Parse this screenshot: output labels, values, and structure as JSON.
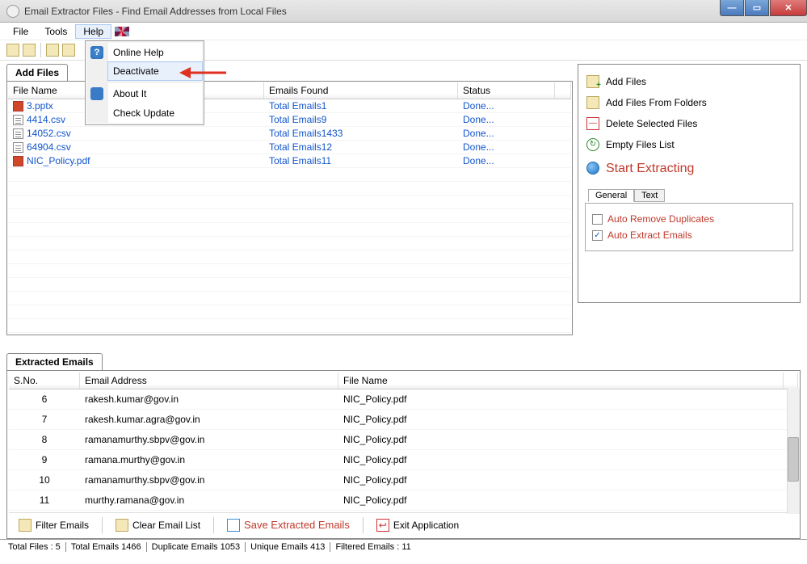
{
  "window": {
    "title": "Email Extractor Files -  Find Email Addresses from Local Files"
  },
  "menubar": {
    "file": "File",
    "tools": "Tools",
    "help": "Help"
  },
  "help_menu": {
    "online_help": "Online Help",
    "deactivate": "Deactivate",
    "about": "About It",
    "check_update": "Check Update"
  },
  "tabs": {
    "add_files": "Add Files",
    "extracted_emails": "Extracted Emails"
  },
  "file_table": {
    "headers": {
      "name": "File Name",
      "emails": "Emails Found",
      "status": "Status"
    },
    "rows": [
      {
        "name": "3.pptx",
        "type": "pptx",
        "emails": "Total Emails1",
        "status": "Done..."
      },
      {
        "name": "4414.csv",
        "type": "csv",
        "emails": "Total Emails9",
        "status": "Done..."
      },
      {
        "name": "14052.csv",
        "type": "csv",
        "emails": "Total Emails1433",
        "status": "Done..."
      },
      {
        "name": "64904.csv",
        "type": "csv",
        "emails": "Total Emails12",
        "status": "Done..."
      },
      {
        "name": "NIC_Policy.pdf",
        "type": "pdf",
        "emails": "Total Emails11",
        "status": "Done..."
      }
    ]
  },
  "sidebar": {
    "add_files": "Add Files",
    "add_folders": "Add Files From Folders",
    "delete_selected": "Delete Selected Files",
    "empty_list": "Empty Files List",
    "start_extract": "Start Extracting",
    "general_tab": "General",
    "text_tab": "Text",
    "auto_remove_dup": "Auto Remove Duplicates",
    "auto_extract": "Auto Extract Emails"
  },
  "extracted": {
    "headers": {
      "sno": "S.No.",
      "email": "Email Address",
      "file": "File Name"
    },
    "rows": [
      {
        "sno": "6",
        "email": "rakesh.kumar@gov.in",
        "file": "NIC_Policy.pdf"
      },
      {
        "sno": "7",
        "email": "rakesh.kumar.agra@gov.in",
        "file": "NIC_Policy.pdf"
      },
      {
        "sno": "8",
        "email": "ramanamurthy.sbpv@gov.in",
        "file": "NIC_Policy.pdf"
      },
      {
        "sno": "9",
        "email": "ramana.murthy@gov.in",
        "file": "NIC_Policy.pdf"
      },
      {
        "sno": "10",
        "email": "ramanamurthy.sbpv@gov.in",
        "file": "NIC_Policy.pdf"
      },
      {
        "sno": "11",
        "email": "murthy.ramana@gov.in",
        "file": "NIC_Policy.pdf"
      }
    ]
  },
  "bottom": {
    "filter": "Filter Emails",
    "clear": "Clear Email List",
    "save": "Save Extracted Emails",
    "exit": "Exit Application"
  },
  "status": {
    "total_files": "Total Files :  5",
    "total_emails": "Total Emails  1466",
    "dup_emails": "Duplicate Emails  1053",
    "unique_emails": "Unique Emails  413",
    "filtered_emails": "Filtered Emails :  11"
  }
}
